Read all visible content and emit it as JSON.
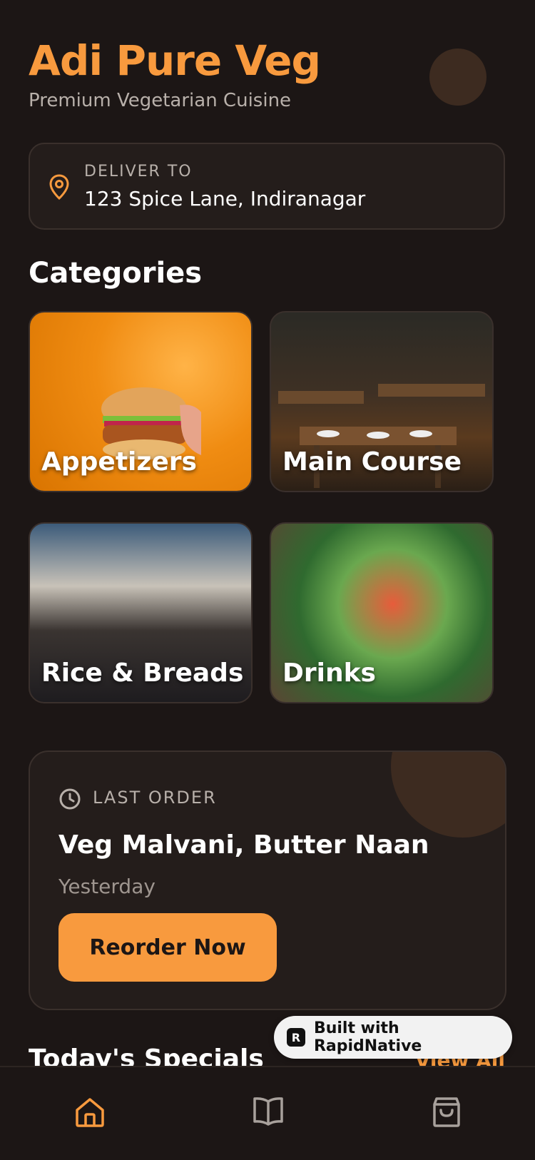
{
  "header": {
    "title": "Adi Pure Veg",
    "subtitle": "Premium Vegetarian Cuisine"
  },
  "delivery": {
    "label": "DELIVER TO",
    "address": "123 Spice Lane, Indiranagar"
  },
  "categories": {
    "title": "Categories",
    "items": [
      {
        "label": "Appetizers"
      },
      {
        "label": "Main Course"
      },
      {
        "label": "Rice & Breads"
      },
      {
        "label": "Drinks"
      }
    ]
  },
  "last_order": {
    "label": "LAST ORDER",
    "items": "Veg Malvani, Butter Naan",
    "when": "Yesterday",
    "button": "Reorder Now"
  },
  "specials": {
    "title": "Today's Specials",
    "view_all": "View All"
  },
  "badge": {
    "text": "Built with RapidNative"
  },
  "nav": [
    {
      "icon": "home-icon",
      "active": true
    },
    {
      "icon": "menu-book-icon",
      "active": false
    },
    {
      "icon": "shopping-bag-icon",
      "active": false
    }
  ],
  "colors": {
    "accent": "#f89a3e",
    "background": "#1c1615",
    "card": "#241d1b"
  }
}
